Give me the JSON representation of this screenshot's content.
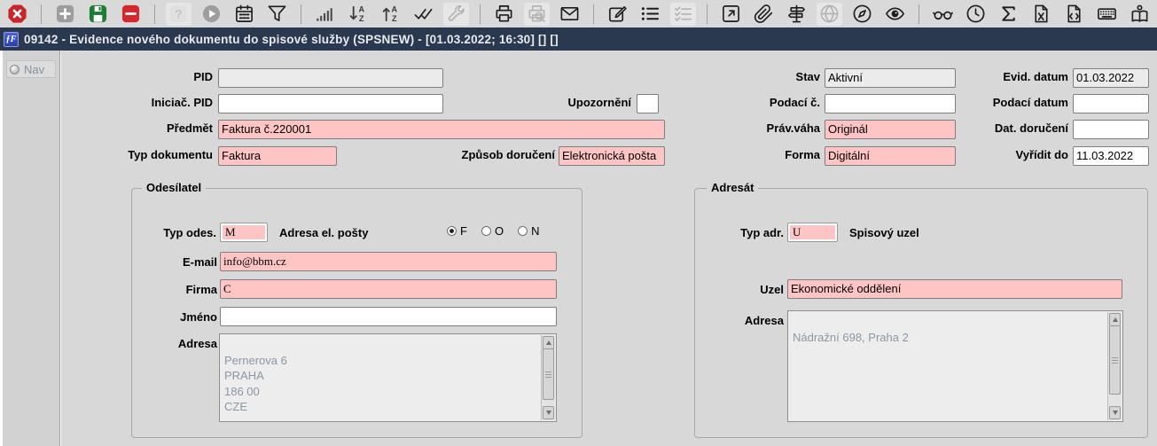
{
  "titlebar": {
    "icon_glyph": "ƒF",
    "title": "09142 - Evidence nového dokumentu do spisové služby (SPSNEW) - [01.03.2022; 16:30] [] []"
  },
  "toolbar": {
    "groups": [
      {
        "icons": [
          {
            "name": "close-icon",
            "dimmed": false
          }
        ]
      },
      {
        "icons": [
          {
            "name": "add-icon",
            "dimmed": false
          },
          {
            "name": "save-icon",
            "dimmed": false
          },
          {
            "name": "delete-icon",
            "dimmed": false
          }
        ]
      },
      {
        "icons": [
          {
            "name": "help-icon",
            "dimmed": true
          },
          {
            "name": "play-icon",
            "dimmed": false
          },
          {
            "name": "calendar-icon",
            "dimmed": false
          },
          {
            "name": "filter-icon",
            "dimmed": false
          }
        ]
      },
      {
        "icons": [
          {
            "name": "bar-chart-icon",
            "dimmed": false
          },
          {
            "name": "sort-desc-icon",
            "dimmed": false
          },
          {
            "name": "sort-asc-icon",
            "dimmed": false
          },
          {
            "name": "double-check-icon",
            "dimmed": false
          },
          {
            "name": "wrench-icon",
            "dimmed": true
          }
        ]
      },
      {
        "icons": [
          {
            "name": "print-icon",
            "dimmed": false
          },
          {
            "name": "print-preview-icon",
            "dimmed": true
          },
          {
            "name": "mail-icon",
            "dimmed": false
          }
        ]
      },
      {
        "icons": [
          {
            "name": "edit-icon",
            "dimmed": false
          },
          {
            "name": "list-icon",
            "dimmed": false
          },
          {
            "name": "checklist-icon",
            "dimmed": true
          }
        ]
      },
      {
        "icons": [
          {
            "name": "external-link-icon",
            "dimmed": false
          },
          {
            "name": "paperclip-icon",
            "dimmed": false
          },
          {
            "name": "signpost-icon",
            "dimmed": false
          },
          {
            "name": "globe-icon",
            "dimmed": true
          },
          {
            "name": "compass-icon",
            "dimmed": false
          },
          {
            "name": "eye-icon",
            "dimmed": false
          }
        ]
      },
      {
        "icons": [
          {
            "name": "glasses-icon",
            "dimmed": false
          },
          {
            "name": "clock-icon",
            "dimmed": false
          },
          {
            "name": "sigma-icon",
            "dimmed": false
          },
          {
            "name": "excel-file-icon",
            "dimmed": false
          },
          {
            "name": "code-file-icon",
            "dimmed": false
          },
          {
            "name": "keyboard-icon",
            "dimmed": false
          },
          {
            "name": "manual-icon",
            "dimmed": false
          }
        ]
      }
    ]
  },
  "sidebar": {
    "nav_label": "Nav"
  },
  "form": {
    "pid": {
      "label": "PID",
      "value": ""
    },
    "iniciac_pid": {
      "label": "Iniciač. PID",
      "value": ""
    },
    "upozorneni": {
      "label": "Upozornění",
      "value": ""
    },
    "predmet": {
      "label": "Předmět",
      "value": "Faktura č.220001"
    },
    "typ_dokumentu": {
      "label": "Typ dokumentu",
      "value": "Faktura"
    },
    "zpusob_doruceni": {
      "label": "Způsob doručení",
      "value": "Elektronická pošta"
    },
    "stav": {
      "label": "Stav",
      "value": "Aktivní"
    },
    "evid_datum": {
      "label": "Evid. datum",
      "value": "01.03.2022"
    },
    "podaci_c": {
      "label": "Podací č.",
      "value": ""
    },
    "podaci_datum": {
      "label": "Podací datum",
      "value": ""
    },
    "prav_vaha": {
      "label": "Práv.váha",
      "value": "Originál"
    },
    "dat_doruceni": {
      "label": "Dat. doručení",
      "value": ""
    },
    "forma": {
      "label": "Forma",
      "value": "Digitální"
    },
    "vyridit_do": {
      "label": "Vyřídit do",
      "value": "11.03.2022"
    }
  },
  "sender": {
    "legend": "Odesílatel",
    "typ_odes": {
      "label": "Typ odes.",
      "value": "M"
    },
    "adresa_el_posty_label": "Adresa el. pošty",
    "radios": [
      {
        "label": "F",
        "selected": true
      },
      {
        "label": "O",
        "selected": false
      },
      {
        "label": "N",
        "selected": false
      }
    ],
    "email": {
      "label": "E-mail",
      "value": "info@bbm.cz"
    },
    "firma": {
      "label": "Firma",
      "value": "C"
    },
    "jmeno": {
      "label": "Jméno",
      "value": ""
    },
    "adresa": {
      "label": "Adresa",
      "lines": [
        "Pernerova 6",
        "PRAHA",
        "186 00",
        "CZE"
      ]
    }
  },
  "addressee": {
    "legend": "Adresát",
    "typ_adr": {
      "label": "Typ adr.",
      "value": "U"
    },
    "spisovy_uzel_label": "Spisový uzel",
    "uzel": {
      "label": "Uzel",
      "value": "Ekonomické oddělení"
    },
    "adresa": {
      "label": "Adresa",
      "lines": [
        "Nádražní 698, Praha 2"
      ]
    }
  },
  "colors": {
    "required_pink": "#ffc5c5",
    "disabled_gray": "#ebebeb",
    "titlebar_navy": "#2b3950",
    "close_red": "#c9252b",
    "save_green": "#1e7c33",
    "area_text_gray": "#8d97a2"
  }
}
